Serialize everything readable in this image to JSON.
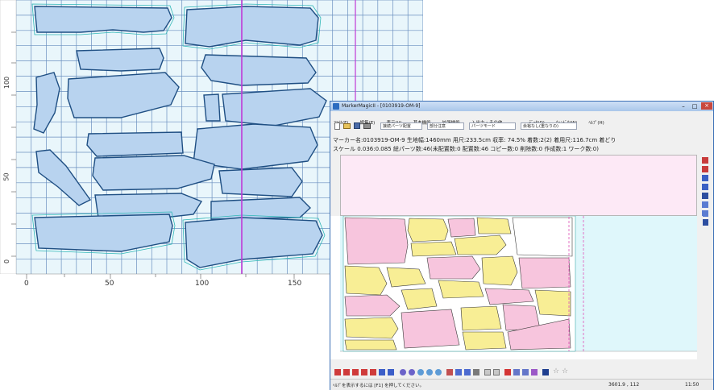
{
  "back_view": {
    "x_ticks": [
      "0",
      "50",
      "100",
      "150"
    ],
    "y_ticks": [
      "100",
      "50",
      "0"
    ],
    "grid_color": "#6a8fbf",
    "piece_color": "#b8d3ef",
    "background": "#e9f6fb"
  },
  "front_window": {
    "title": "MarkerMagicII - [0103919-OM-9]",
    "menu": [
      "ﾌｧｲﾙ(F)",
      "編集(E)",
      "表示(V)",
      "基本機能",
      "拡張機能",
      "入出力・その他",
      "ﾃﾞｰﾀ(D)",
      "ｳｨﾝﾄﾞｳ(W)",
      "ﾍﾙﾌﾟ(H)"
    ],
    "toolbar_combos": [
      "接続パーツ配置",
      "部分注意",
      "パーツモード",
      "余裕なし(重なりの)"
    ],
    "info_line_1": "マーカー名:0103919-OM-9 生地幅:1460mm 用尺:233.5cm 収率: 74.5% 着数:2(2) 着用尺:116.7cm 着どり",
    "info_line_2": "スケール 0.036:0.085 総パーツ数:46(未配置数:0 配置数:46 コピー数:0 削除数:0 作成数:1 ワーク数:0)",
    "status_left": "ﾍﾙﾌﾟを表示するには [F1] を押してください。",
    "status_coords": "3601.9 , 112",
    "status_right": "11:50",
    "colors": {
      "accent_pink": "#f7c5dd",
      "accent_yellow": "#f8ee95",
      "top_area": "#fde9f6",
      "work_area": "#dff7fb",
      "window_frame": "#3b6fb5"
    }
  }
}
